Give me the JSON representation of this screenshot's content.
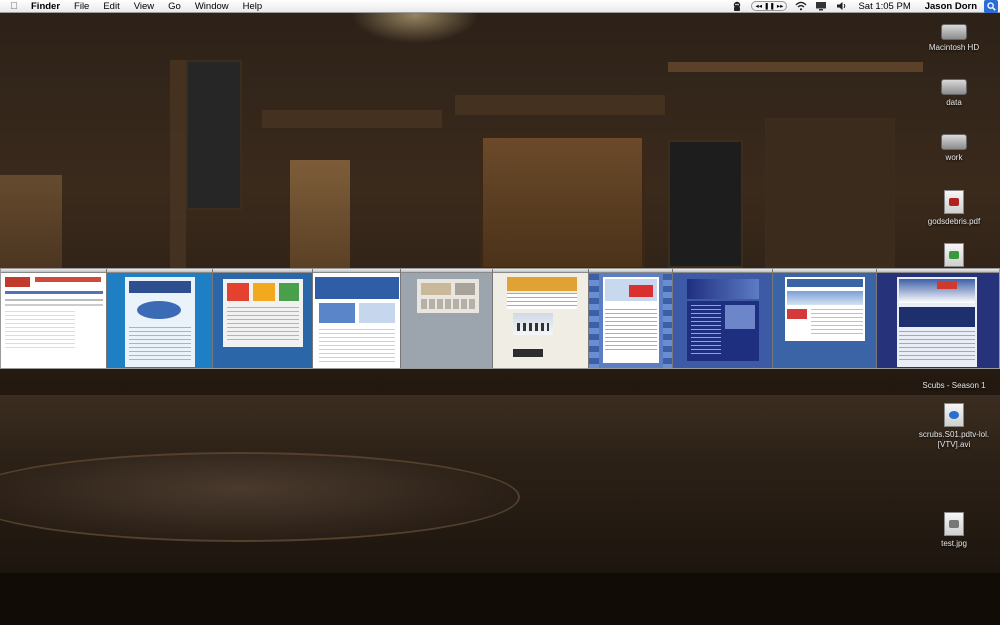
{
  "menubar": {
    "app_name": "Finder",
    "menus": [
      "File",
      "Edit",
      "View",
      "Go",
      "Window",
      "Help"
    ],
    "clock": "Sat 1:05 PM",
    "user": "Jason Dorn",
    "status_icons": [
      "adium-icon",
      "itunes-controls",
      "wifi-icon",
      "display-icon",
      "volume-icon"
    ],
    "itunes_buttons": [
      "◂◂",
      "❚❚",
      "▸▸"
    ]
  },
  "desktop_icons": [
    {
      "label": "Macintosh HD",
      "icon": "hard-drive-icon"
    },
    {
      "label": "data",
      "icon": "hard-drive-icon"
    },
    {
      "label": "work",
      "icon": "hard-drive-icon"
    },
    {
      "label": "godsdebris.pdf",
      "icon": "pdf-document-icon"
    },
    {
      "label": "",
      "icon": "music-file-icon"
    },
    {
      "label": "Scubs - Season 1",
      "icon": "folder-icon"
    },
    {
      "label": "scrubs.S01.pdtv-lol.[VTV].avi",
      "label_line1": "scrubs.S01.pdtv-lol.",
      "label_line2": "[VTV].avi",
      "icon": "video-file-icon"
    },
    {
      "label": "test.jpg",
      "icon": "image-file-icon"
    }
  ],
  "window_thumbnails": [
    {
      "name": "forum-page-window",
      "bg": "#ffffff",
      "accent": "#c23a2b"
    },
    {
      "name": "blue-portal-window",
      "bg": "#1f7fc4",
      "accent": "#e7f1fa"
    },
    {
      "name": "ad-network-window",
      "bg": "#2a66a8",
      "accent": "#e2422f"
    },
    {
      "name": "tech-news-window",
      "bg": "#ffffff",
      "accent": "#2f5ea7"
    },
    {
      "name": "grey-gallery-window",
      "bg": "#9ca5ad",
      "accent": "#c9b89a"
    },
    {
      "name": "ski-blog-window",
      "bg": "#ffffff",
      "accent": "#e0a234"
    },
    {
      "name": "snowboard-shop-window",
      "bg": "#5b7ec4",
      "accent": "#ffffff"
    },
    {
      "name": "resort-site-window",
      "bg": "#3c5aa6",
      "accent": "#1f2f80"
    },
    {
      "name": "weather-site-window",
      "bg": "#3b64a6",
      "accent": "#ffffff"
    },
    {
      "name": "mountain-site-window",
      "bg": "#26337a",
      "accent": "#e9eef6"
    }
  ],
  "colors": {
    "menubar": "#ececec",
    "spotlight": "#2b6cd6",
    "desktop_label": "#e8e8e8"
  }
}
